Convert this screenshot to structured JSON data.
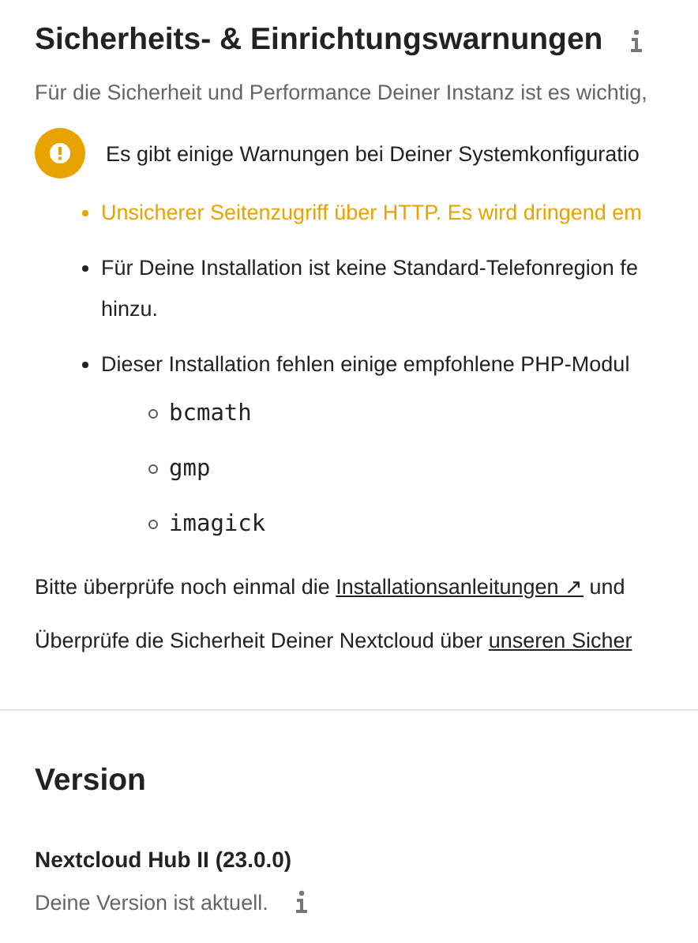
{
  "security": {
    "title": "Sicherheits- & Einrichtungswarnungen",
    "intro": "Für die Sicherheit und Performance Deiner Instanz ist es wichtig,",
    "warning": "Es gibt einige Warnungen bei Deiner Systemkonfiguratio",
    "items": [
      {
        "kind": "warning",
        "lines": [
          "Unsicherer Seitenzugriff über HTTP. Es wird dringend em"
        ]
      },
      {
        "kind": "info",
        "lines": [
          "Für Deine Installation ist keine Standard-Telefonregion fe",
          "hinzu."
        ]
      },
      {
        "kind": "info",
        "lines": [
          "Dieser Installation fehlen einige empfohlene PHP-Modul"
        ],
        "children": [
          "bcmath",
          "gmp",
          "imagick"
        ]
      }
    ],
    "check_text": {
      "before": "Bitte überprüfe noch einmal die ",
      "link": "Installationsanleitungen ↗",
      "after": " und"
    },
    "scan_text": {
      "before": "Überprüfe die Sicherheit Deiner Nextcloud über ",
      "link": "unseren Sicher"
    }
  },
  "version": {
    "title": "Version",
    "name": "Nextcloud Hub II (23.0.0)",
    "status": "Deine Version ist aktuell."
  }
}
